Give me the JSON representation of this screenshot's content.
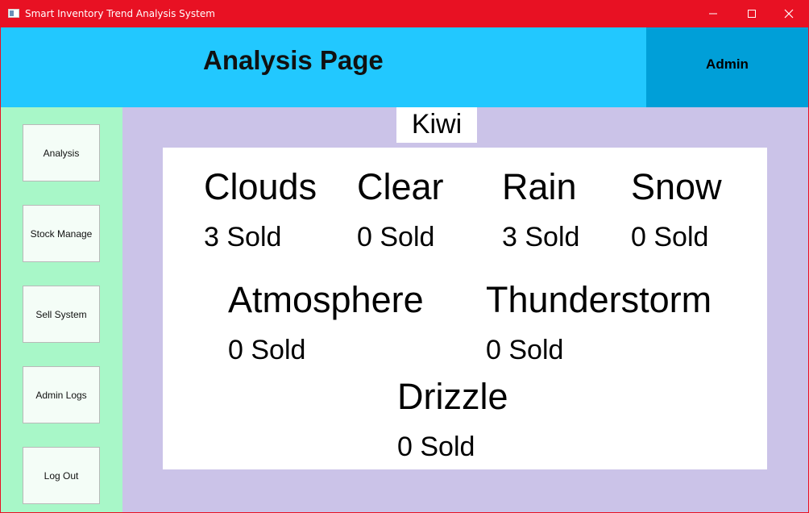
{
  "window": {
    "title": "Smart Inventory Trend Analysis System",
    "colors": {
      "titlebar": "#e81123",
      "header": "#22c8ff",
      "admin_panel": "#009fd8",
      "sidebar": "#a8f7c8",
      "content_bg": "#cbc3e8"
    }
  },
  "titlebar": {
    "app_icon": "window-app-icon",
    "minimize_icon": "minimize-icon",
    "maximize_icon": "maximize-icon",
    "close_icon": "close-icon"
  },
  "header": {
    "title": "Analysis Page",
    "user_label": "Admin"
  },
  "sidebar": {
    "items": [
      {
        "label": "Analysis"
      },
      {
        "label": "Stock Manage"
      },
      {
        "label": "Sell System"
      },
      {
        "label": "Admin Logs"
      },
      {
        "label": "Log Out"
      }
    ]
  },
  "analysis": {
    "product": "Kiwi",
    "weather": [
      {
        "name": "Clouds",
        "sold": "3 Sold"
      },
      {
        "name": "Clear",
        "sold": "0 Sold"
      },
      {
        "name": "Rain",
        "sold": "3 Sold"
      },
      {
        "name": "Snow",
        "sold": "0 Sold"
      },
      {
        "name": "Atmosphere",
        "sold": "0 Sold"
      },
      {
        "name": "Thunderstorm",
        "sold": "0 Sold"
      },
      {
        "name": "Drizzle",
        "sold": "0 Sold"
      }
    ]
  }
}
